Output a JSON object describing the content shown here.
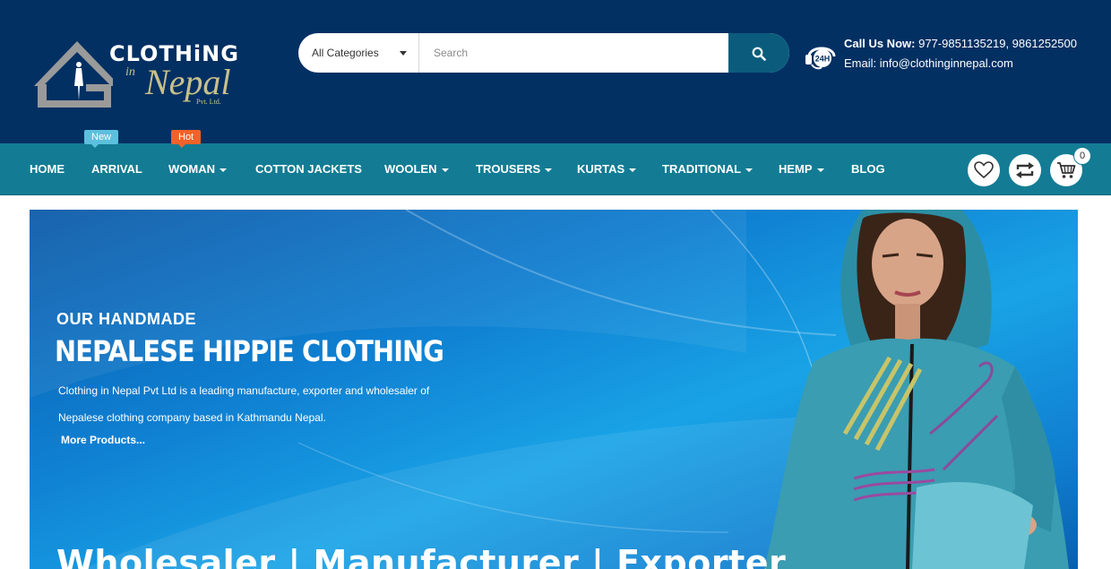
{
  "header": {
    "logo": {
      "line1": "CLOTHiNG",
      "line_in": "in",
      "line2": "Nepal",
      "line3": "Pvt. Ltd."
    },
    "search": {
      "category_selected": "All Categories",
      "placeholder": "Search",
      "value": ""
    },
    "contact": {
      "call_label": "Call Us Now:",
      "phones": "977-9851135219, 9861252500",
      "email_line": "Email: info@clothinginnepal.com",
      "support_badge": "24H"
    }
  },
  "nav": {
    "items": [
      {
        "label": "HOME"
      },
      {
        "label": "ARRIVAL",
        "badge": "New"
      },
      {
        "label": "WOMAN",
        "badge": "Hot"
      },
      {
        "label": "COTTON JACKETS"
      },
      {
        "label": "WOOLEN"
      },
      {
        "label": "TROUSERS"
      },
      {
        "label": "KURTAS"
      },
      {
        "label": "TRADITIONAL"
      },
      {
        "label": "HEMP"
      },
      {
        "label": "BLOG"
      }
    ],
    "cart_count": "0",
    "icons": [
      "heart-icon",
      "compare-icon",
      "cart-icon"
    ]
  },
  "hero": {
    "kicker": "OUR HANDMADE",
    "headline": "NEPALESE HIPPIE CLOTHING",
    "desc_line1": "Clothing in Nepal Pvt Ltd is a leading manufacture, exporter and wholesaler of",
    "desc_line2": "Nepalese clothing company based in Kathmandu Nepal.",
    "more_link": "More Products...",
    "tagline": "Wholesaler | Manufacturer | Exporter"
  },
  "colors": {
    "header_bg": "#023063",
    "nav_bg": "#137c94",
    "search_button": "#0b5c7c",
    "badge_new": "#5bc0de",
    "badge_hot": "#f0622a",
    "logo_gold": "#c9c08a"
  }
}
